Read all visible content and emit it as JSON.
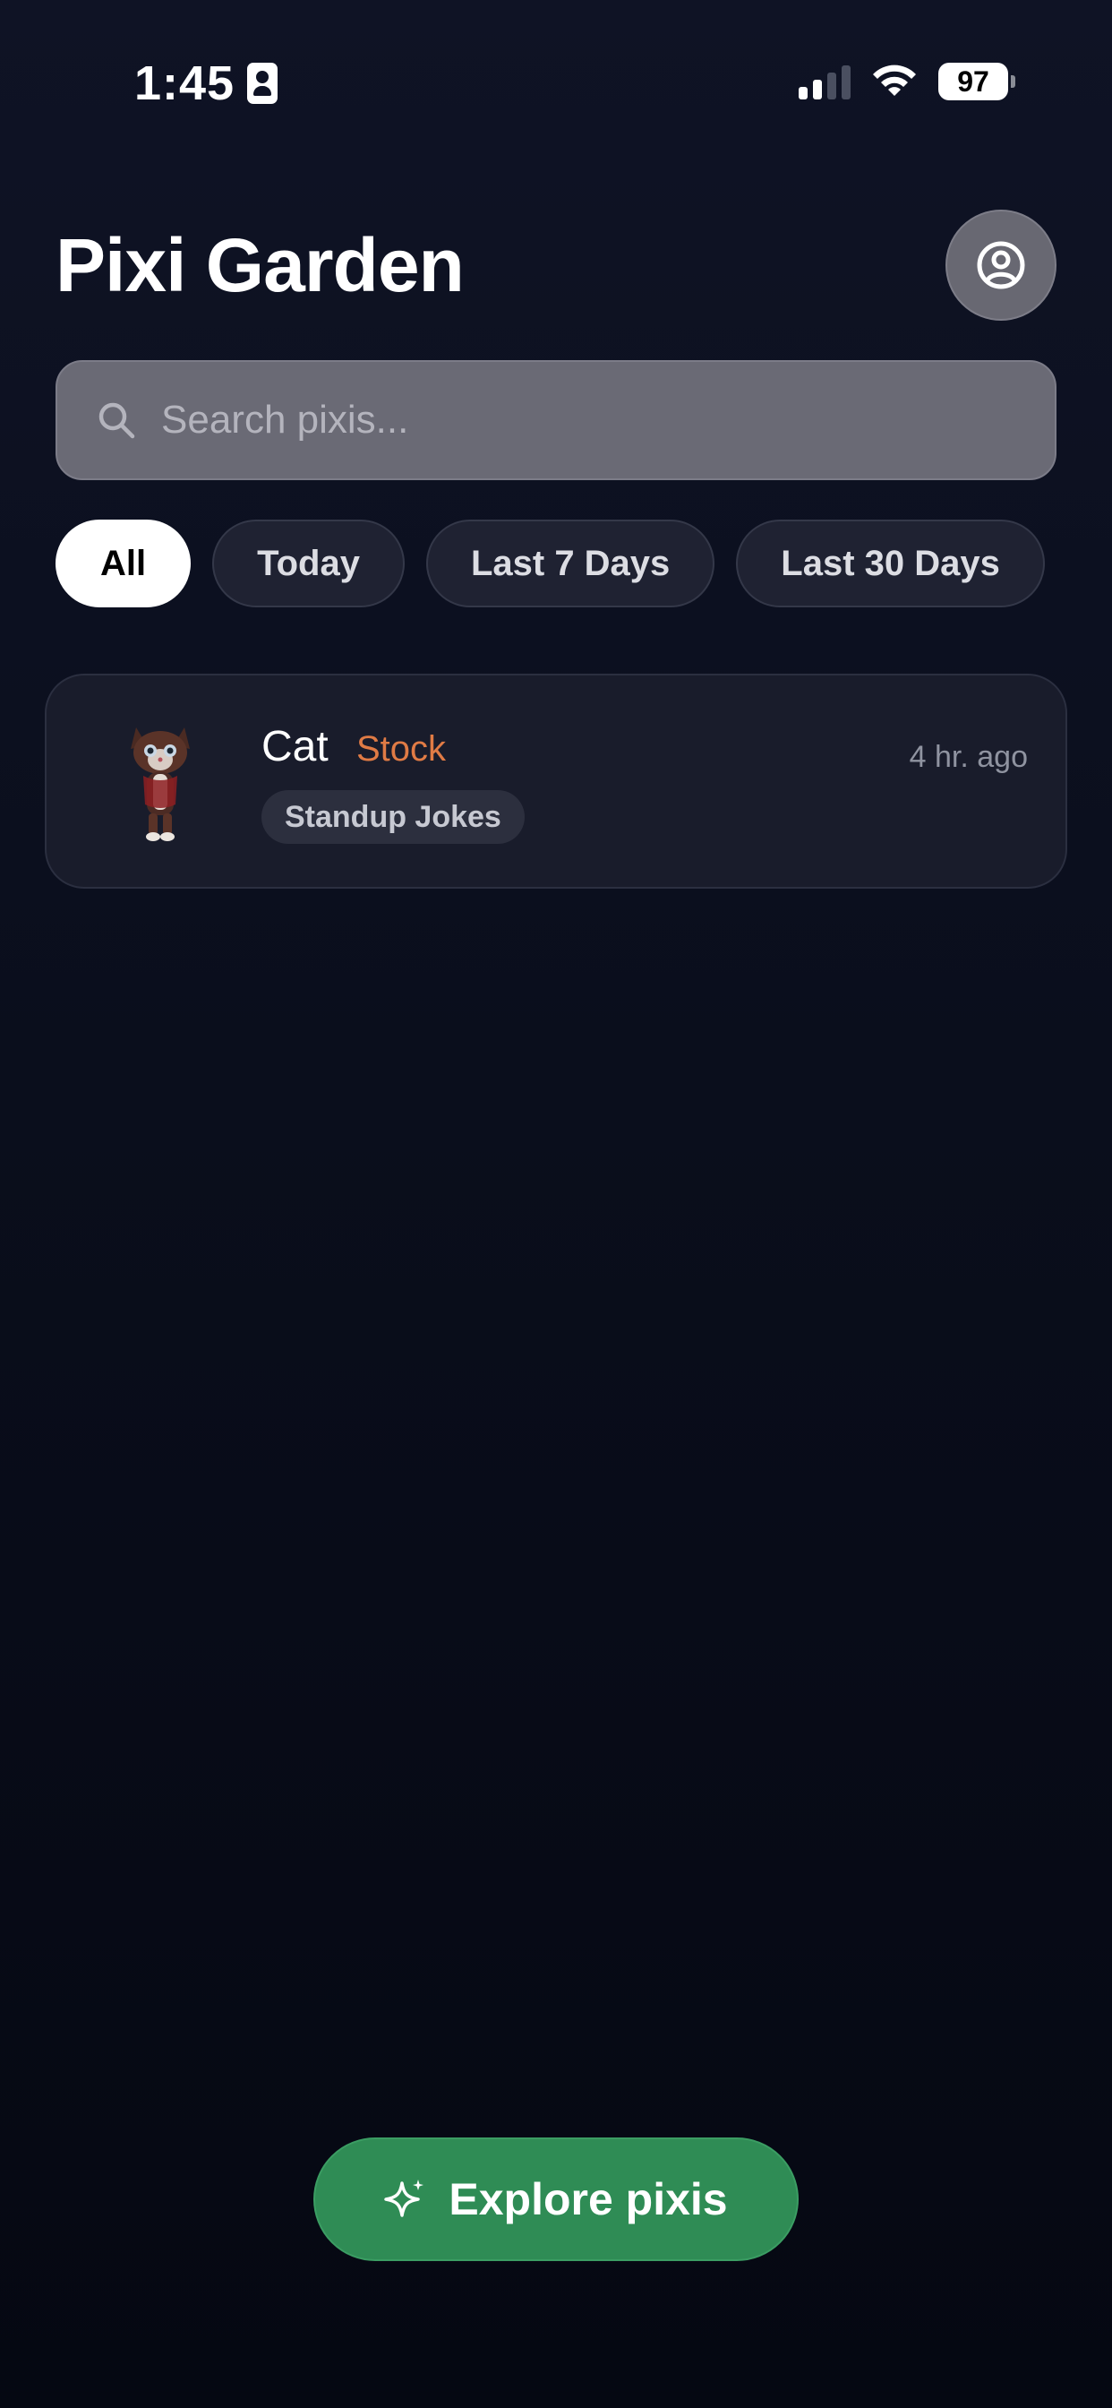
{
  "status_bar": {
    "time": "1:45",
    "battery": "97"
  },
  "header": {
    "title": "Pixi Garden",
    "profile_icon": "user-circle-icon"
  },
  "search": {
    "placeholder": "Search pixis...",
    "icon": "search-icon"
  },
  "filters": [
    {
      "label": "All",
      "active": true
    },
    {
      "label": "Today",
      "active": false
    },
    {
      "label": "Last 7 Days",
      "active": false
    },
    {
      "label": "Last 30 Days",
      "active": false
    }
  ],
  "pixis": [
    {
      "name": "Cat",
      "type": "Stock",
      "time": "4 hr. ago",
      "tag": "Standup Jokes",
      "avatar": "cat-figure"
    }
  ],
  "footer": {
    "explore_label": "Explore pixis",
    "explore_icon": "sparkles-icon"
  },
  "colors": {
    "background": "#0a0e1c",
    "accent_green": "#2f8c55",
    "stock_orange": "#e07b45",
    "card_bg": "#191c2b"
  }
}
